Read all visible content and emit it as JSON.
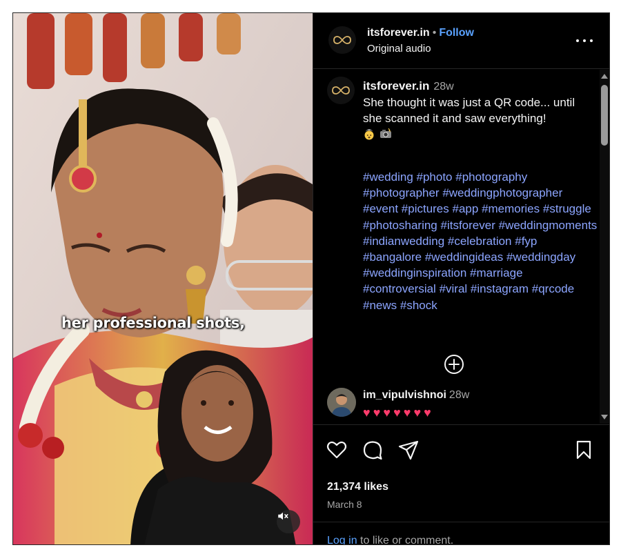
{
  "post": {
    "account": "itsforever.in",
    "separator": "•",
    "follow_label": "Follow",
    "audio": "Original audio"
  },
  "media": {
    "overlay_caption": "her professional shots,",
    "mute_icon": "speaker-muted-icon"
  },
  "caption": {
    "username": "itsforever.in",
    "time": "28w",
    "text": "She thought it was just a QR code... until she scanned it and saw everything!",
    "emojis": [
      "exploding-head-emoji",
      "camera-with-flash-emoji"
    ],
    "hashtags": [
      "#wedding",
      "#photo",
      "#photography",
      "#photographer",
      "#weddingphotographer",
      "#event",
      "#pictures",
      "#app",
      "#memories",
      "#struggle",
      "#photosharing",
      "#itsforever",
      "#weddingmoments",
      "#indianwedding",
      "#celebration",
      "#fyp",
      "#bangalore",
      "#weddingideas",
      "#weddingday",
      "#weddinginspiration",
      "#marriage",
      "#controversial",
      "#viral",
      "#instagram",
      "#qrcode",
      "#news",
      "#shock"
    ]
  },
  "comments": [
    {
      "username": "im_vipulvishnoi",
      "time": "28w",
      "text": "♥♥♥♥♥♥♥"
    }
  ],
  "actions": {
    "icons": [
      "heart-icon",
      "comment-icon",
      "share-icon",
      "bookmark-icon"
    ],
    "likes": "21,374 likes",
    "date": "March 8",
    "login_link": "Log in",
    "login_text": " to like or comment."
  },
  "colors": {
    "background": "#000000",
    "link_blue": "#5aa2ff",
    "hashtag": "#8ca5ff",
    "heart_emoji": "#ff3b6b",
    "muted_text": "#a8a8a8"
  }
}
